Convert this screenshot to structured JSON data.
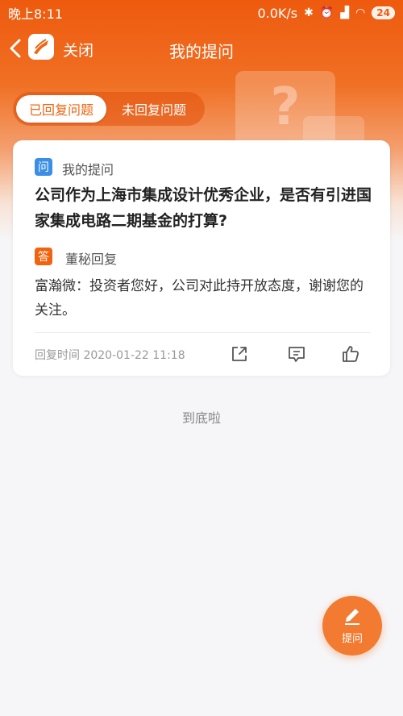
{
  "status_bar": {
    "time": "晚上8:11",
    "network_speed": "0.0K/s",
    "battery": "24"
  },
  "nav": {
    "close_label": "关闭",
    "title": "我的提问"
  },
  "tabs": [
    {
      "label": "已回复问题",
      "active": true
    },
    {
      "label": "未回复问题",
      "active": false
    }
  ],
  "card": {
    "question_badge": "问",
    "question_label": "我的提问",
    "question_text": "公司作为上海市集成设计优秀企业，是否有引进国家集成电路二期基金的打算?",
    "answer_badge": "答",
    "answer_label": "董秘回复",
    "answer_text": "富瀚微：投资者您好，公司对此持开放态度，谢谢您的关注。",
    "reply_time": "回复时间 2020-01-22 11:18"
  },
  "footer_text": "到底啦",
  "fab_label": "提问",
  "colors": {
    "accent": "#f0640f",
    "question_badge": "#3a8ee6",
    "background": "#f6f6f8"
  },
  "icons": {
    "back": "chevron-left-icon",
    "share": "share-icon",
    "comment": "comment-icon",
    "like": "thumbs-up-icon",
    "ask": "pencil-icon"
  }
}
